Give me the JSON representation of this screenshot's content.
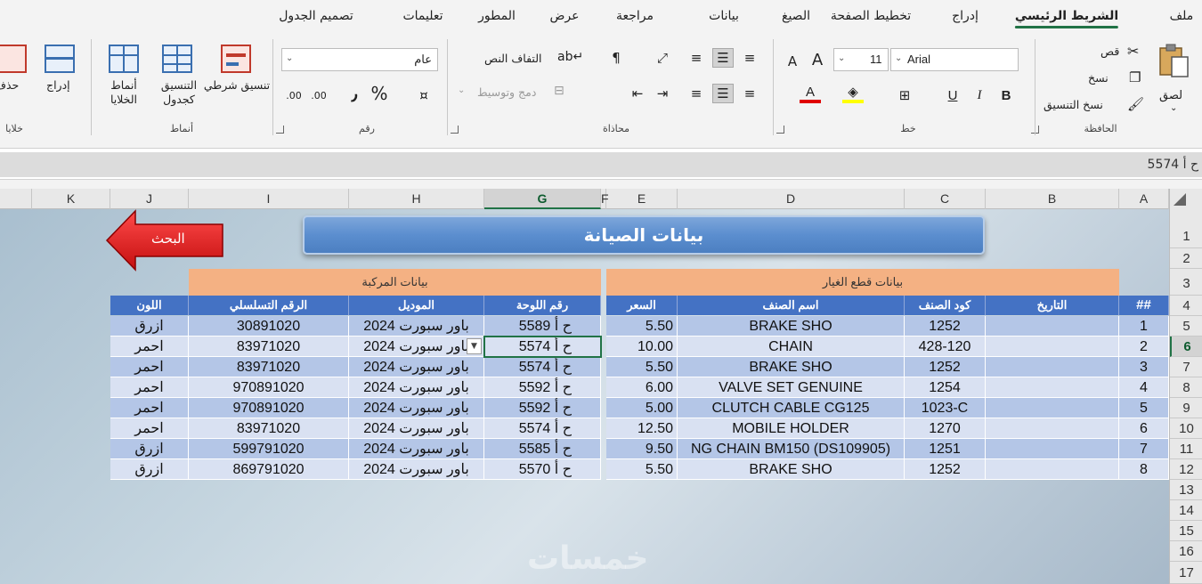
{
  "tabs": [
    "ملف",
    "الشريط الرئيسي",
    "إدراج",
    "تخطيط الصفحة",
    "الصيغ",
    "بيانات",
    "مراجعة",
    "عرض",
    "المطور",
    "تعليمات",
    "تصميم الجدول"
  ],
  "ribbon": {
    "clipboard": {
      "group": "الحافظة",
      "paste": "لصق",
      "cut": "قص",
      "copy": "نسخ",
      "format_painter": "نسخ التنسيق"
    },
    "font": {
      "group": "خط",
      "name": "Arial",
      "size": "11",
      "bold": "B",
      "italic": "I",
      "underline": "U",
      "grow": "A",
      "shrink": "A"
    },
    "alignment": {
      "group": "محاذاة",
      "wrap": "التفاف النص",
      "merge": "دمج وتوسيط"
    },
    "number": {
      "group": "رقم",
      "format": "عام",
      "percent": "%",
      "comma": "٫",
      "inc_decimal": ".00",
      "dec_decimal": ".00"
    },
    "styles": {
      "group": "أنماط",
      "conditional": "تنسيق شرطي",
      "table": "التنسيق كجدول",
      "cell_styles": "أنماط الخلايا"
    },
    "cells": {
      "group": "خلايا",
      "insert": "إدراج",
      "delete": "حذف"
    }
  },
  "formula_bar": {
    "name_box": "ح أ 5574"
  },
  "columns": [
    "A",
    "B",
    "C",
    "D",
    "E",
    "F",
    "G",
    "H",
    "I",
    "J",
    "K"
  ],
  "rows": [
    "1",
    "2",
    "3",
    "4",
    "5",
    "6",
    "7",
    "8",
    "9",
    "10",
    "11",
    "12",
    "13",
    "14",
    "15",
    "16",
    "17"
  ],
  "selected": {
    "column": "G",
    "row": "6"
  },
  "sheet": {
    "title": "بيانات الصيانة",
    "search_button": "البحث",
    "groups": {
      "parts": "بيانات قطع الغيار",
      "vehicle": "بيانات المركبة"
    },
    "headers": [
      "##",
      "التاريخ",
      "كود الصنف",
      "اسم الصنف",
      "السعر",
      "رقم اللوحة",
      "الموديل",
      "الرقم التسلسلي",
      "اللون"
    ],
    "rows": [
      [
        "1",
        "",
        "1252",
        "BRAKE SHO",
        "5.50",
        "ح أ 5589",
        "باور سبورت 2024",
        "30891020",
        "ازرق"
      ],
      [
        "2",
        "",
        "428-120",
        "CHAIN",
        "10.00",
        "ح أ 5574",
        "باور سبورت 2024",
        "83971020",
        "احمر"
      ],
      [
        "3",
        "",
        "1252",
        "BRAKE SHO",
        "5.50",
        "ح أ 5574",
        "باور سبورت 2024",
        "83971020",
        "احمر"
      ],
      [
        "4",
        "",
        "1254",
        "VALVE SET GENUINE",
        "6.00",
        "ح أ 5592",
        "باور سبورت 2024",
        "970891020",
        "احمر"
      ],
      [
        "5",
        "",
        "1023-C",
        "CLUTCH CABLE CG125",
        "5.00",
        "ح أ 5592",
        "باور سبورت 2024",
        "970891020",
        "احمر"
      ],
      [
        "6",
        "",
        "1270",
        "MOBILE HOLDER",
        "12.50",
        "ح أ 5574",
        "باور سبورت 2024",
        "83971020",
        "احمر"
      ],
      [
        "7",
        "",
        "1251",
        "NG CHAIN BM150 (DS109905)",
        "9.50",
        "ح أ 5585",
        "باور سبورت 2024",
        "599791020",
        "ازرق"
      ],
      [
        "8",
        "",
        "1252",
        "BRAKE SHO",
        "5.50",
        "ح أ 5570",
        "باور سبورت 2024",
        "869791020",
        "ازرق"
      ]
    ],
    "watermark": "خمسات"
  },
  "colors": {
    "header_blue": "#4472c4",
    "band_dark": "#b4c6e7",
    "band_light": "#d9e1f2",
    "group_orange": "#f4b183",
    "search_red": "#e31b1b",
    "accent_green": "#217346"
  }
}
